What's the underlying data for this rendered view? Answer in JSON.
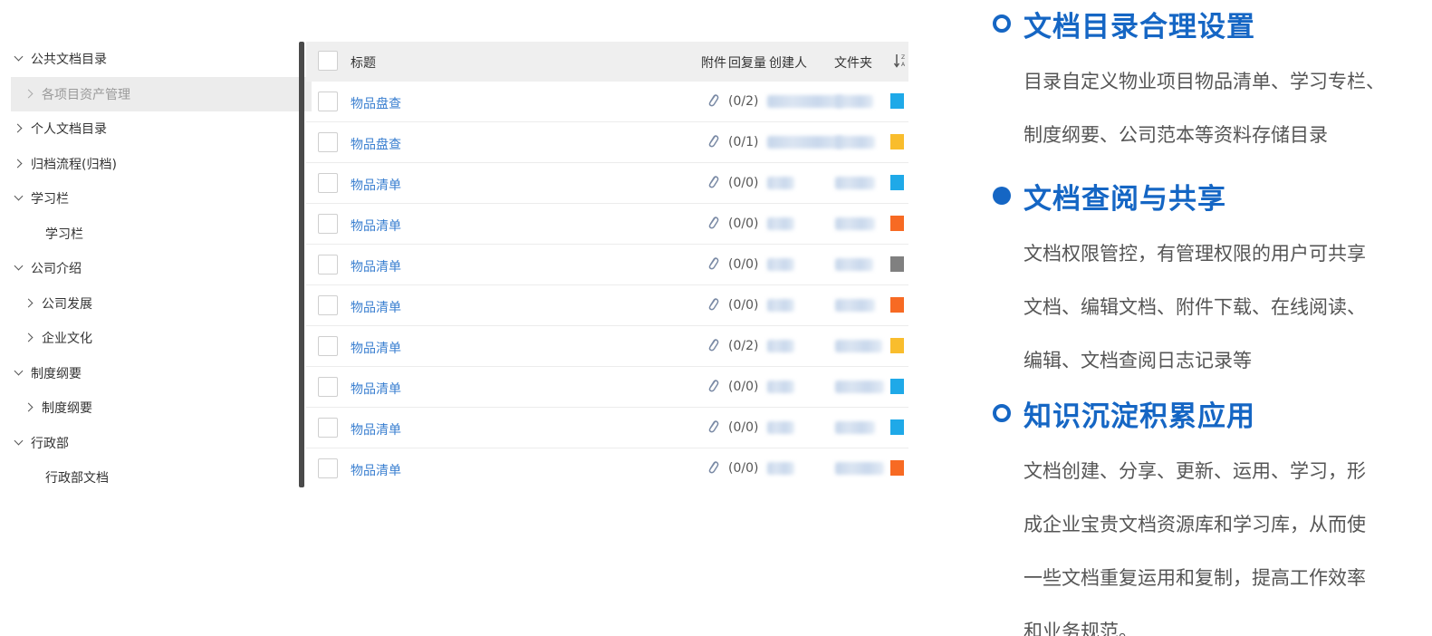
{
  "tree": {
    "items": [
      {
        "label": "公共文档目录",
        "level": 0,
        "arrow": "down",
        "selected": false
      },
      {
        "label": "各项目资产管理",
        "level": 1,
        "arrow": "right",
        "selected": true
      },
      {
        "label": "个人文档目录",
        "level": 0,
        "arrow": "right",
        "selected": false
      },
      {
        "label": "归档流程(归档)",
        "level": 0,
        "arrow": "right",
        "selected": false
      },
      {
        "label": "学习栏",
        "level": 0,
        "arrow": "down",
        "selected": false
      },
      {
        "label": "学习栏",
        "level": 2,
        "arrow": "none",
        "selected": false
      },
      {
        "label": "公司介绍",
        "level": 0,
        "arrow": "down",
        "selected": false
      },
      {
        "label": "公司发展",
        "level": 1,
        "arrow": "right",
        "selected": false
      },
      {
        "label": "企业文化",
        "level": 1,
        "arrow": "right",
        "selected": false
      },
      {
        "label": "制度纲要",
        "level": 0,
        "arrow": "down",
        "selected": false
      },
      {
        "label": "制度纲要",
        "level": 1,
        "arrow": "right",
        "selected": false
      },
      {
        "label": "行政部",
        "level": 0,
        "arrow": "down",
        "selected": false
      },
      {
        "label": "行政部文档",
        "level": 2,
        "arrow": "none",
        "selected": false
      }
    ]
  },
  "table": {
    "headers": {
      "title": "标题",
      "attachment": "附件",
      "replies": "回复量",
      "creator": "创建人",
      "folder": "文件夹"
    },
    "rows": [
      {
        "title": "物品盘查",
        "replies": "(0/2)",
        "color": "#1fa9e8"
      },
      {
        "title": "物品盘查",
        "replies": "(0/1)",
        "color": "#f9bd2d"
      },
      {
        "title": "物品清单",
        "replies": "(0/0)",
        "color": "#1fa9e8"
      },
      {
        "title": "物品清单",
        "replies": "(0/0)",
        "color": "#f76a23"
      },
      {
        "title": "物品清单",
        "replies": "(0/0)",
        "color": "#808080"
      },
      {
        "title": "物品清单",
        "replies": "(0/0)",
        "color": "#f76a23"
      },
      {
        "title": "物品清单",
        "replies": "(0/2)",
        "color": "#f9bd2d"
      },
      {
        "title": "物品清单",
        "replies": "(0/0)",
        "color": "#1fa9e8"
      },
      {
        "title": "物品清单",
        "replies": "(0/0)",
        "color": "#1fa9e8"
      },
      {
        "title": "物品清单",
        "replies": "(0/0)",
        "color": "#f76a23"
      }
    ]
  },
  "features": [
    {
      "title": "文档目录合理设置",
      "bullet": "hollow",
      "lines": [
        "目录自定义物业项目物品清单、学习专栏、",
        "制度纲要、公司范本等资料存储目录"
      ]
    },
    {
      "title": "文档查阅与共享",
      "bullet": "filled",
      "lines": [
        "文档权限管控，有管理权限的用户可共享",
        "文档、编辑文档、附件下载、在线阅读、",
        "编辑、文档查阅日志记录等"
      ]
    },
    {
      "title": "知识沉淀积累应用",
      "bullet": "hollow",
      "lines": [
        "文档创建、分享、更新、运用、学习，形",
        "成企业宝贵文档资源库和学习库，从而使",
        "一些文档重复运用和复制，提高工作效率",
        "和业务规范。"
      ]
    }
  ],
  "colors": {
    "accent": "#1566c4",
    "link": "#3a7fd0"
  }
}
